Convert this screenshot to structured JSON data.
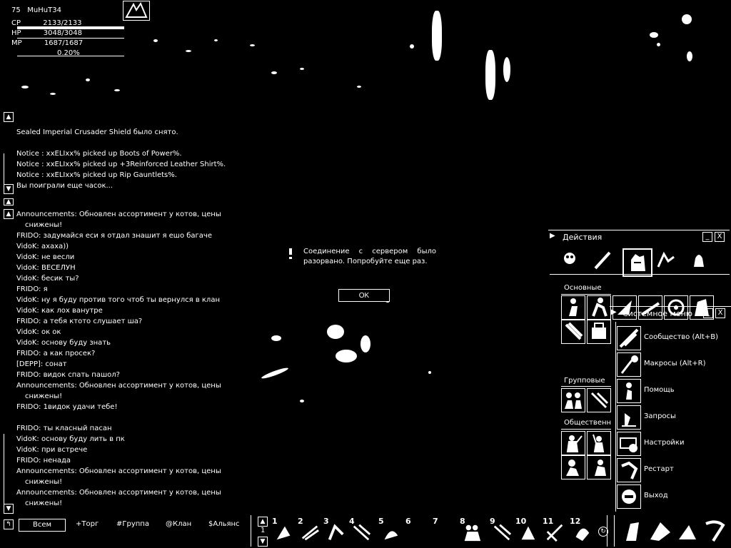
{
  "character": {
    "level": "75",
    "name": "MuHuT34",
    "cp": "2133/2133",
    "hp": "3048/3048",
    "mp": "1687/1687",
    "exp": "0.20%",
    "cp_label": "CP",
    "hp_label": "HP",
    "mp_label": "MP"
  },
  "system_log": [
    "Sealed Imperial Crusader Shield было снято.",
    "Notice : xxELIxx% picked up Boots of Power%.",
    "Notice : xxELIxx% picked up +3Reinforced Leather Shirt%.",
    "Notice : xxELIxx% picked up Rip Gauntlets%.",
    "Вы поиграли еще часок..."
  ],
  "chat_lines": [
    {
      "text": "Announcements: Обновлен ассортимент у котов, цены"
    },
    {
      "text": "снижены!",
      "cont": true
    },
    {
      "text": "FRIDO: задумайся еси я отдал знашит я ешо багаче"
    },
    {
      "text": "VidoK: ахаха))"
    },
    {
      "text": "VidoK: не весли"
    },
    {
      "text": "VidoK: ВЕСЕЛУН"
    },
    {
      "text": "VidoK: бесик ты?"
    },
    {
      "text": "FRIDO: я"
    },
    {
      "text": "VidoK: ну я буду против того чтоб ты вернулся в клан"
    },
    {
      "text": "VidoK: как лох ванутре"
    },
    {
      "text": "FRIDO: а тебя ктото слушает ша?"
    },
    {
      "text": "VidoK: ок ок"
    },
    {
      "text": "VidoK: основу буду знать"
    },
    {
      "text": "FRIDO: а как просек?"
    },
    {
      "text": "[DEPP]: сонат"
    },
    {
      "text": "FRIDO: видок спать пашол?"
    },
    {
      "text": "Announcements: Обновлен ассортимент у котов, цены"
    },
    {
      "text": "снижены!",
      "cont": true
    },
    {
      "text": "FRIDO: 1видок удачи тебе!"
    },
    {
      "text": ""
    },
    {
      "text": "FRIDO: ты класный пасан"
    },
    {
      "text": "VidoK: основу буду лить в пк"
    },
    {
      "text": "VidoK: при встрече"
    },
    {
      "text": "FRIDO: ненада"
    },
    {
      "text": "Announcements: Обновлен ассортимент у котов, цены"
    },
    {
      "text": "снижены!",
      "cont": true
    },
    {
      "text": "Announcements: Обновлен ассортимент у котов, цены"
    },
    {
      "text": "снижены!",
      "cont": true
    }
  ],
  "chat_tabs": {
    "all": "Всем",
    "trade": "+Торг",
    "party": "#Группа",
    "clan": "@Клан",
    "alliance": "$Альянс"
  },
  "dialog": {
    "message": "Соединение с сервером было разорвано. Попробуйте еще раз.",
    "ok": "OK"
  },
  "actions_window": {
    "title": "Действия",
    "section_basic": "Основные",
    "section_party": "Групповые",
    "section_social": "Общественн",
    "min": "_",
    "close": "X"
  },
  "system_menu": {
    "title": "Системное меню",
    "min": "_",
    "close": "X",
    "items": [
      {
        "label": "Сообщество (Alt+B)",
        "icon": "community-icon"
      },
      {
        "label": "Макросы (Alt+R)",
        "icon": "macro-icon"
      },
      {
        "label": "Помощь",
        "icon": "help-icon"
      },
      {
        "label": "Запросы",
        "icon": "petition-icon"
      },
      {
        "label": "Настройки",
        "icon": "settings-icon"
      },
      {
        "label": "Рестарт",
        "icon": "restart-icon"
      },
      {
        "label": "Выход",
        "icon": "exit-icon"
      }
    ]
  },
  "hotbar": {
    "page": "1",
    "slots": [
      "1",
      "2",
      "3",
      "4",
      "5",
      "6",
      "7",
      "8",
      "9",
      "10",
      "11",
      "12"
    ]
  },
  "colors": {
    "background": "#000000",
    "foreground": "#ffffff"
  }
}
